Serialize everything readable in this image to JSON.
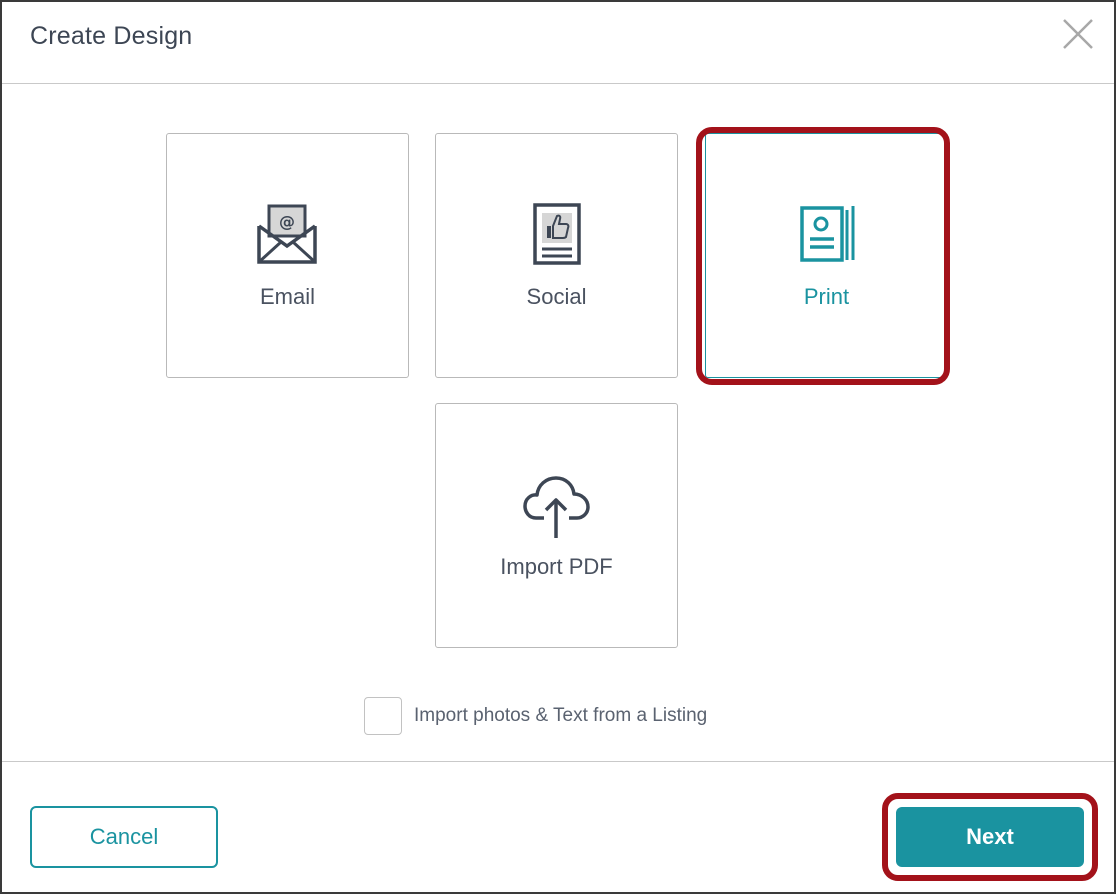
{
  "dialog": {
    "title": "Create Design",
    "close_icon": "close-icon"
  },
  "tiles": [
    {
      "label": "Email",
      "icon": "envelope-at-icon",
      "selected": false
    },
    {
      "label": "Social",
      "icon": "social-thumbs-up-icon",
      "selected": false
    },
    {
      "label": "Print",
      "icon": "print-brochure-icon",
      "selected": true
    },
    {
      "label": "Import PDF",
      "icon": "cloud-upload-icon",
      "selected": false
    }
  ],
  "import_listing": {
    "label": "Import photos & Text from a Listing",
    "checked": false
  },
  "footer": {
    "cancel_label": "Cancel",
    "next_label": "Next"
  },
  "colors": {
    "accent": "#1a93a0",
    "highlight": "#a3121a",
    "icon_dark": "#3d4654"
  }
}
